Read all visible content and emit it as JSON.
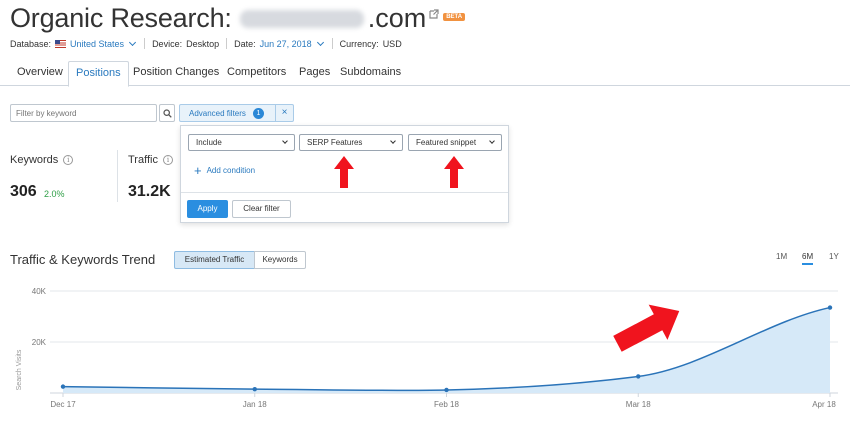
{
  "header": {
    "title": "Organic Research:",
    "domain_tld": ".com",
    "beta_badge": "BETA"
  },
  "meta": {
    "database_label": "Database:",
    "database_value": "United States",
    "device_label": "Device:",
    "device_value": "Desktop",
    "date_label": "Date:",
    "date_value": "Jun 27, 2018",
    "currency_label": "Currency:",
    "currency_value": "USD"
  },
  "tabs": [
    {
      "label": "Overview"
    },
    {
      "label": "Positions",
      "active": true
    },
    {
      "label": "Position Changes"
    },
    {
      "label": "Competitors"
    },
    {
      "label": "Pages"
    },
    {
      "label": "Subdomains"
    }
  ],
  "filters": {
    "keyword_placeholder": "Filter by keyword",
    "advanced_label": "Advanced filters",
    "advanced_count": "1",
    "close_glyph": "×"
  },
  "advanced_popover": {
    "include_select": "Include",
    "field_select": "SERP Features",
    "value_select": "Featured snippet",
    "add_condition": "Add condition",
    "apply": "Apply",
    "clear": "Clear filter"
  },
  "stats": {
    "keywords_label": "Keywords",
    "keywords_value": "306",
    "keywords_delta": "2.0%",
    "traffic_label": "Traffic",
    "traffic_value": "31.2K"
  },
  "trend": {
    "title": "Traffic & Keywords Trend",
    "toggle_traffic": "Estimated Traffic",
    "toggle_keywords": "Keywords",
    "range_1m": "1M",
    "range_6m": "6M",
    "range_1y": "1Y",
    "active_range": "6M"
  },
  "chart_data": {
    "type": "area",
    "x": [
      "Dec 17",
      "Jan 18",
      "Feb 18",
      "Mar 18",
      "Apr 18"
    ],
    "series": [
      {
        "values": [
          2500,
          1500,
          1200,
          6500,
          33500
        ]
      }
    ],
    "ylabel": "Search Visits",
    "yticks": [
      "40K",
      "20K"
    ],
    "ylim": [
      0,
      40000
    ],
    "grid": true
  },
  "colors": {
    "accent": "#2a7abf",
    "area_fill": "#d6e9f8",
    "line": "#2a73b8",
    "arrow": "#f0141e",
    "delta_positive": "#2e9e46"
  },
  "icons": [
    "external-link-icon",
    "us-flag-icon",
    "chevron-down-icon",
    "search-icon",
    "info-icon",
    "plus-icon",
    "red-arrow-icon"
  ]
}
